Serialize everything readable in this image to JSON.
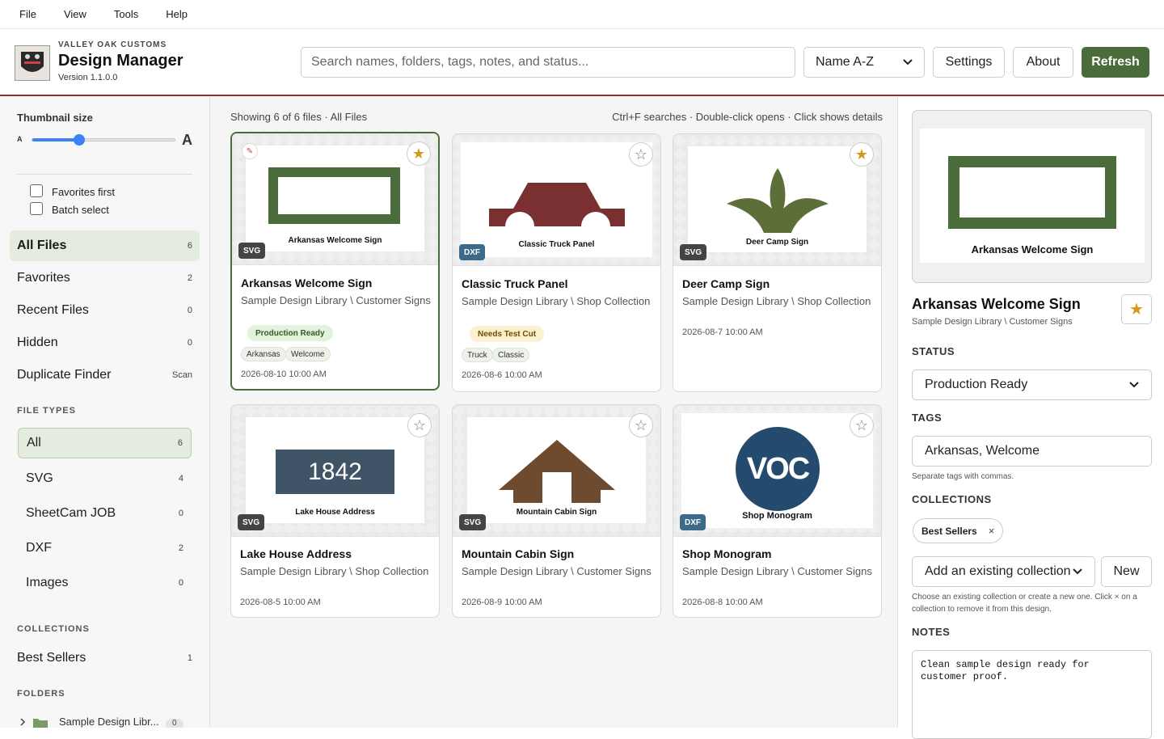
{
  "menu": [
    "File",
    "View",
    "Tools",
    "Help"
  ],
  "header": {
    "brand_small": "VALLEY OAK CUSTOMS",
    "title": "Design Manager",
    "version": "Version 1.1.0.0",
    "search_placeholder": "Search names, folders, tags, notes, and status...",
    "sort_value": "Name A-Z",
    "settings_label": "Settings",
    "about_label": "About",
    "refresh_label": "Refresh"
  },
  "sidebar": {
    "thumb_size_label": "Thumbnail size",
    "thumb_small": "A",
    "thumb_large": "A",
    "thumb_size_fraction": 0.33,
    "favorites_first": "Favorites first",
    "batch_select": "Batch select",
    "nav": [
      {
        "label": "All Files",
        "count": "6"
      },
      {
        "label": "Favorites",
        "count": "2"
      },
      {
        "label": "Recent Files",
        "count": "0"
      },
      {
        "label": "Hidden",
        "count": "0"
      },
      {
        "label": "Duplicate Finder",
        "count": "Scan"
      }
    ],
    "file_types_heading": "FILE TYPES",
    "file_types": [
      {
        "label": "All",
        "count": "6"
      },
      {
        "label": "SVG",
        "count": "4"
      },
      {
        "label": "SheetCam JOB",
        "count": "0"
      },
      {
        "label": "DXF",
        "count": "2"
      },
      {
        "label": "Images",
        "count": "0"
      }
    ],
    "collections_heading": "COLLECTIONS",
    "collections": [
      {
        "label": "Best Sellers",
        "count": "1"
      }
    ],
    "folders_heading": "FOLDERS",
    "folder": {
      "label": "Sample Design Libr...",
      "count": "0"
    }
  },
  "main": {
    "showing": "Showing 6 of 6 files · All Files",
    "hints": "Ctrl+F searches · Double-click opens · Click shows details",
    "cards": [
      {
        "name": "Arkansas Welcome Sign",
        "path": "Sample Design Library \\ Customer Signs",
        "date": "2026-08-10 10:00 AM",
        "type": "SVG",
        "thumb_label": "Arkansas Welcome Sign",
        "status": "Production Ready",
        "tags": [
          "Arkansas",
          "Welcome"
        ]
      },
      {
        "name": "Classic Truck Panel",
        "path": "Sample Design Library \\ Shop Collection",
        "date": "2026-08-6 10:00 AM",
        "type": "DXF",
        "thumb_label": "Classic Truck Panel",
        "status": "Needs Test Cut",
        "tags": [
          "Truck",
          "Classic"
        ]
      },
      {
        "name": "Deer Camp Sign",
        "path": "Sample Design Library \\ Shop Collection",
        "date": "2026-08-7 10:00 AM",
        "type": "SVG",
        "thumb_label": "Deer Camp Sign"
      },
      {
        "name": "Lake House Address",
        "path": "Sample Design Library \\ Shop Collection",
        "date": "2026-08-5 10:00 AM",
        "type": "SVG",
        "thumb_label": "Lake House Address",
        "thumb_number": "1842"
      },
      {
        "name": "Mountain Cabin Sign",
        "path": "Sample Design Library \\ Customer Signs",
        "date": "2026-08-9 10:00 AM",
        "type": "SVG",
        "thumb_label": "Mountain Cabin Sign"
      },
      {
        "name": "Shop Monogram",
        "path": "Sample Design Library \\ Customer Signs",
        "date": "2026-08-8 10:00 AM",
        "type": "DXF",
        "thumb_label": "Shop Monogram",
        "thumb_mono": "VOC"
      }
    ]
  },
  "details": {
    "preview_label": "Arkansas Welcome Sign",
    "title": "Arkansas Welcome Sign",
    "path": "Sample Design Library \\ Customer Signs",
    "status_heading": "STATUS",
    "status_value": "Production Ready",
    "tags_heading": "TAGS",
    "tags_value": "Arkansas, Welcome",
    "tags_hint": "Separate tags with commas.",
    "collections_heading": "COLLECTIONS",
    "collection_chip": "Best Sellers",
    "collection_chip_remove": "×",
    "add_collection": "Add an existing collection",
    "new_label": "New",
    "collections_hint": "Choose an existing collection or create a new one. Click × on a collection to remove it from this design.",
    "notes_heading": "NOTES",
    "notes_value": "Clean sample design ready for\ncustomer proof."
  },
  "colors": {
    "accent": "#4a6b3a",
    "header_rule": "#9b2f2f",
    "star": "#d39a1a",
    "dxf_badge": "#3e6a8a"
  },
  "icons": [
    "star-icon",
    "chevron-down-icon",
    "folder-icon",
    "chevron-right-icon",
    "edit-icon",
    "remove-icon"
  ]
}
